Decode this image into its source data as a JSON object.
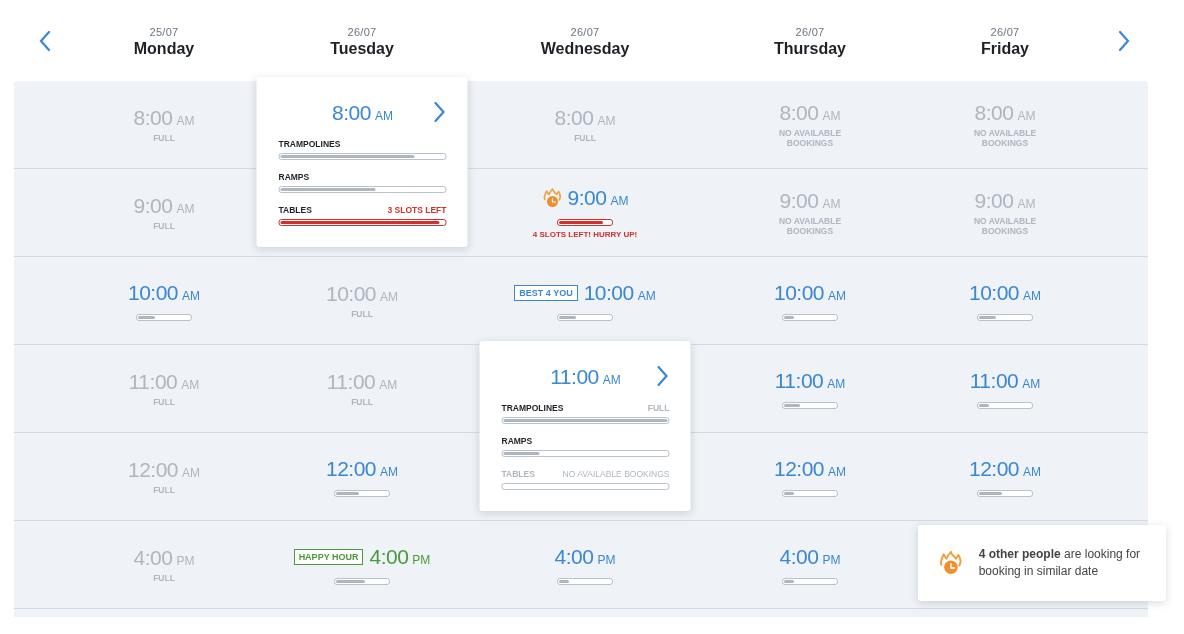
{
  "days": [
    {
      "date": "25/07",
      "name": "Monday"
    },
    {
      "date": "26/07",
      "name": "Tuesday"
    },
    {
      "date": "26/07",
      "name": "Wednesday"
    },
    {
      "date": "26/07",
      "name": "Thursday"
    },
    {
      "date": "26/07",
      "name": "Friday"
    }
  ],
  "rows": [
    {
      "cells": [
        {
          "kind": "full",
          "time": "8:00",
          "period": "AM",
          "note": "FULL"
        },
        {
          "kind": "expanded",
          "time": "8:00",
          "period": "AM",
          "resources": [
            {
              "name": "TRAMPOLINES",
              "kind": "normal",
              "level": 0.82
            },
            {
              "name": "RAMPS",
              "kind": "normal",
              "level": 0.58
            },
            {
              "name": "TABLES",
              "kind": "alert",
              "status": "3 SLOTS LEFT",
              "level": 0.97
            }
          ]
        },
        {
          "kind": "full",
          "time": "8:00",
          "period": "AM",
          "note": "FULL"
        },
        {
          "kind": "full",
          "time": "8:00",
          "period": "AM",
          "note": "NO AVAILABLE BOOKINGS"
        },
        {
          "kind": "full",
          "time": "8:00",
          "period": "AM",
          "note": "NO AVAILABLE BOOKINGS"
        }
      ]
    },
    {
      "cells": [
        {
          "kind": "full",
          "time": "9:00",
          "period": "AM",
          "note": "FULL"
        },
        {
          "kind": "covered"
        },
        {
          "kind": "hot",
          "time": "9:00",
          "period": "AM",
          "level": 0.85,
          "note": "4 SLOTS LEFT! HURRY UP!"
        },
        {
          "kind": "full",
          "time": "9:00",
          "period": "AM",
          "note": "NO AVAILABLE BOOKINGS"
        },
        {
          "kind": "full",
          "time": "9:00",
          "period": "AM",
          "note": "NO AVAILABLE BOOKINGS"
        }
      ]
    },
    {
      "cells": [
        {
          "kind": "open",
          "time": "10:00",
          "period": "AM",
          "level": 0.32
        },
        {
          "kind": "full",
          "time": "10:00",
          "period": "AM",
          "note": "FULL"
        },
        {
          "kind": "open",
          "time": "10:00",
          "period": "AM",
          "level": 0.32,
          "badge": "BEST 4 YOU",
          "color": "#3a87d3"
        },
        {
          "kind": "open",
          "time": "10:00",
          "period": "AM",
          "level": 0.2
        },
        {
          "kind": "open",
          "time": "10:00",
          "period": "AM",
          "level": 0.32
        }
      ]
    },
    {
      "cells": [
        {
          "kind": "full",
          "time": "11:00",
          "period": "AM",
          "note": "FULL"
        },
        {
          "kind": "full",
          "time": "11:00",
          "period": "AM",
          "note": "FULL"
        },
        {
          "kind": "expanded",
          "time": "11:00",
          "period": "AM",
          "resources": [
            {
              "name": "TRAMPOLINES",
              "kind": "normal",
              "status": "FULL",
              "level": 1
            },
            {
              "name": "RAMPS",
              "kind": "normal",
              "level": 0.22
            },
            {
              "name": "TABLES",
              "kind": "disabled",
              "status": "NO AVAILABLE BOOKINGS"
            }
          ]
        },
        {
          "kind": "open",
          "time": "11:00",
          "period": "AM",
          "level": 0.3
        },
        {
          "kind": "open",
          "time": "11:00",
          "period": "AM",
          "level": 0.2
        }
      ]
    },
    {
      "cells": [
        {
          "kind": "full",
          "time": "12:00",
          "period": "AM",
          "note": "FULL"
        },
        {
          "kind": "open",
          "time": "12:00",
          "period": "AM",
          "level": 0.45
        },
        {
          "kind": "covered"
        },
        {
          "kind": "open",
          "time": "12:00",
          "period": "AM",
          "level": 0.2
        },
        {
          "kind": "open",
          "time": "12:00",
          "period": "AM",
          "level": 0.45
        }
      ]
    },
    {
      "cells": [
        {
          "kind": "full",
          "time": "4:00",
          "period": "PM",
          "note": "FULL"
        },
        {
          "kind": "open",
          "time": "4:00",
          "period": "PM",
          "level": 0.55,
          "badge": "HAPPY HOUR",
          "color": "#4a9a3c"
        },
        {
          "kind": "open",
          "time": "4:00",
          "period": "PM",
          "level": 0.2
        },
        {
          "kind": "open",
          "time": "4:00",
          "period": "PM",
          "level": 0.2
        },
        {
          "kind": "covered"
        }
      ]
    }
  ],
  "toast": {
    "text": "**4 other people** are looking for booking in similar date"
  }
}
